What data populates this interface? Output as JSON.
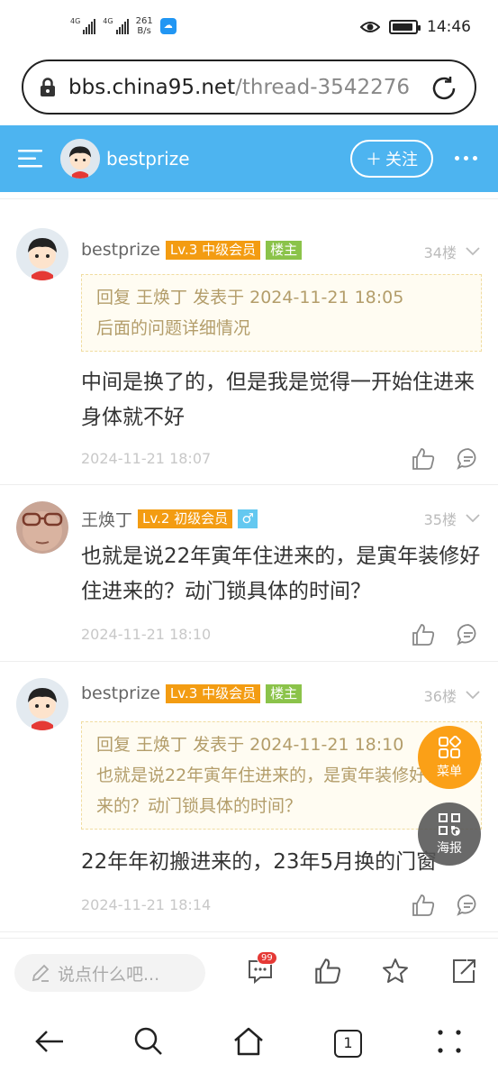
{
  "status_bar": {
    "signal1": "4G",
    "signal2": "4G",
    "speed_value": "261",
    "speed_unit": "B/s",
    "time": "14:46",
    "battery_level": 0.9
  },
  "browser": {
    "url_domain": "bbs.china95.net",
    "url_path": "/thread-3542276"
  },
  "topnav": {
    "author": "bestprize",
    "follow_label": "关注"
  },
  "posts": [
    {
      "user": "bestprize",
      "level": "Lv.3 中级会员",
      "owner_tag": "楼主",
      "floor": "34楼",
      "quote_line1": "回复 王焕丁 发表于 2024-11-21 18:05",
      "quote_line2": "后面的问题详细情况",
      "text": "中间是换了的，但是我是觉得一开始住进来身体就不好",
      "time": "2024-11-21 18:07"
    },
    {
      "user": "王焕丁",
      "level": "Lv.2 初级会员",
      "gender": "♂",
      "floor": "35楼",
      "text": "也就是说22年寅年住进来的，是寅年装修好住进来的？动门锁具体的时间？",
      "time": "2024-11-21 18:10"
    },
    {
      "user": "bestprize",
      "level": "Lv.3 中级会员",
      "owner_tag": "楼主",
      "floor": "36楼",
      "quote_line1": "回复 王焕丁 发表于 2024-11-21 18:10",
      "quote_line2": "也就是说22年寅年住进来的，是寅年装修好住进来的？动门锁具体的时间？",
      "text": "22年年初搬进来的，23年5月换的门窗",
      "time": "2024-11-21 18:14"
    }
  ],
  "floating": {
    "menu_label": "菜单",
    "poster_label": "海报"
  },
  "bottom_bar": {
    "comment_placeholder": "说点什么吧...",
    "comment_badge": "99"
  },
  "system_nav": {
    "tab_count": "1"
  },
  "colors": {
    "nav_blue": "#4db4f0",
    "level_orange": "#f39c12",
    "owner_green": "#8bc34a",
    "float_orange": "#fba017"
  }
}
